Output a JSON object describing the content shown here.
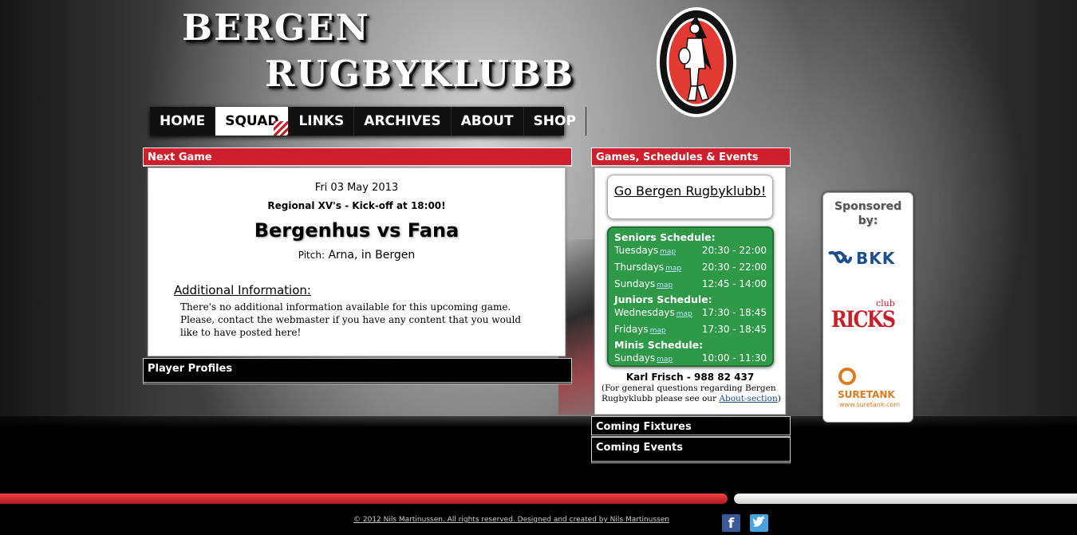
{
  "header": {
    "title_line1": "BERGEN",
    "title_line2": "RUGBYKLUBB"
  },
  "nav": {
    "items": [
      "HOME",
      "SQUAD",
      "LINKS",
      "ARCHIVES",
      "ABOUT",
      "SHOP"
    ],
    "active": "SQUAD"
  },
  "next_game": {
    "heading": "Next Game",
    "date": "Fri 03 May 2013",
    "match_type": "Regional XV's - Kick-off at 18:00!",
    "match": "Bergenhus vs Fana",
    "pitch_label": "Pitch:",
    "pitch_value": "Arna, in Bergen",
    "additional_heading": "Additional Information:",
    "additional_text": "There's no additional information available for this upcoming game. Please, contact the webmaster if you have any content that you would like to have posted here!"
  },
  "player_profiles": {
    "heading": "Player Profiles"
  },
  "schedules": {
    "heading": "Games, Schedules & Events",
    "go_button": "Go Bergen Rugbyklubb!",
    "map_label": "map",
    "sections": [
      {
        "title": "Seniors Schedule:",
        "rows": [
          {
            "day": "Tuesdays",
            "time": "20:30 - 22:00"
          },
          {
            "day": "Thursdays",
            "time": "20:30 - 22:00"
          },
          {
            "day": "Sundays",
            "time": "12:45 - 14:00"
          }
        ]
      },
      {
        "title": "Juniors Schedule:",
        "rows": [
          {
            "day": "Wednesdays",
            "time": "17:30 - 18:45"
          },
          {
            "day": "Fridays",
            "time": "17:30 - 18:45"
          }
        ]
      },
      {
        "title": "Minis Schedule:",
        "rows": [
          {
            "day": "Sundays",
            "time": "10:00 - 11:30"
          }
        ]
      }
    ],
    "contact_name": "Karl Frisch - 988 82 437",
    "contact_note_before": "(For general questions regarding Bergen Rugbyklubb please see our ",
    "contact_link": "About-section",
    "contact_note_after": ")"
  },
  "fixtures": {
    "heading": "Coming Fixtures"
  },
  "events": {
    "heading": "Coming Events"
  },
  "sponsors": {
    "title": "Sponsored by:",
    "items": [
      {
        "name": "BKK"
      },
      {
        "name_top": "club",
        "name": "RICKS"
      },
      {
        "name": "SURETANK",
        "url_text": "www.suretank.com"
      }
    ]
  },
  "footer": {
    "copyright": "© 2012 Nils Martinussen. All rights reserved. Designed and created by Nils Martinussen",
    "facebook": "f"
  },
  "colors": {
    "brand_red": "#cf1f2d",
    "schedule_green": "#2e9a48",
    "nav_bg": "#111111",
    "facebook_blue": "#3b5998",
    "twitter_blue": "#4aa3df"
  }
}
